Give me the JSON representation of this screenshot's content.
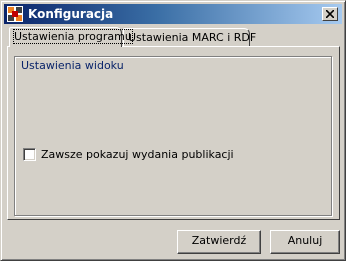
{
  "window": {
    "title": "Konfiguracja",
    "icon": "app-config-icon",
    "close_icon": "close-icon"
  },
  "tabs": [
    {
      "label": "Ustawienia programu",
      "active": true
    },
    {
      "label": "Ustawienia MARC i RDF",
      "active": false
    }
  ],
  "group": {
    "title": "Ustawienia widoku"
  },
  "options": {
    "show_editions_label": "Zawsze pokazuj wydania publikacji",
    "show_editions_checked": false
  },
  "buttons": {
    "confirm_label": "Zatwierdź",
    "cancel_label": "Anuluj"
  },
  "colors": {
    "titlebar_start": "#0a246a",
    "titlebar_end": "#a6caf0",
    "face": "#d4d0c8",
    "group_title": "#0a246a"
  }
}
